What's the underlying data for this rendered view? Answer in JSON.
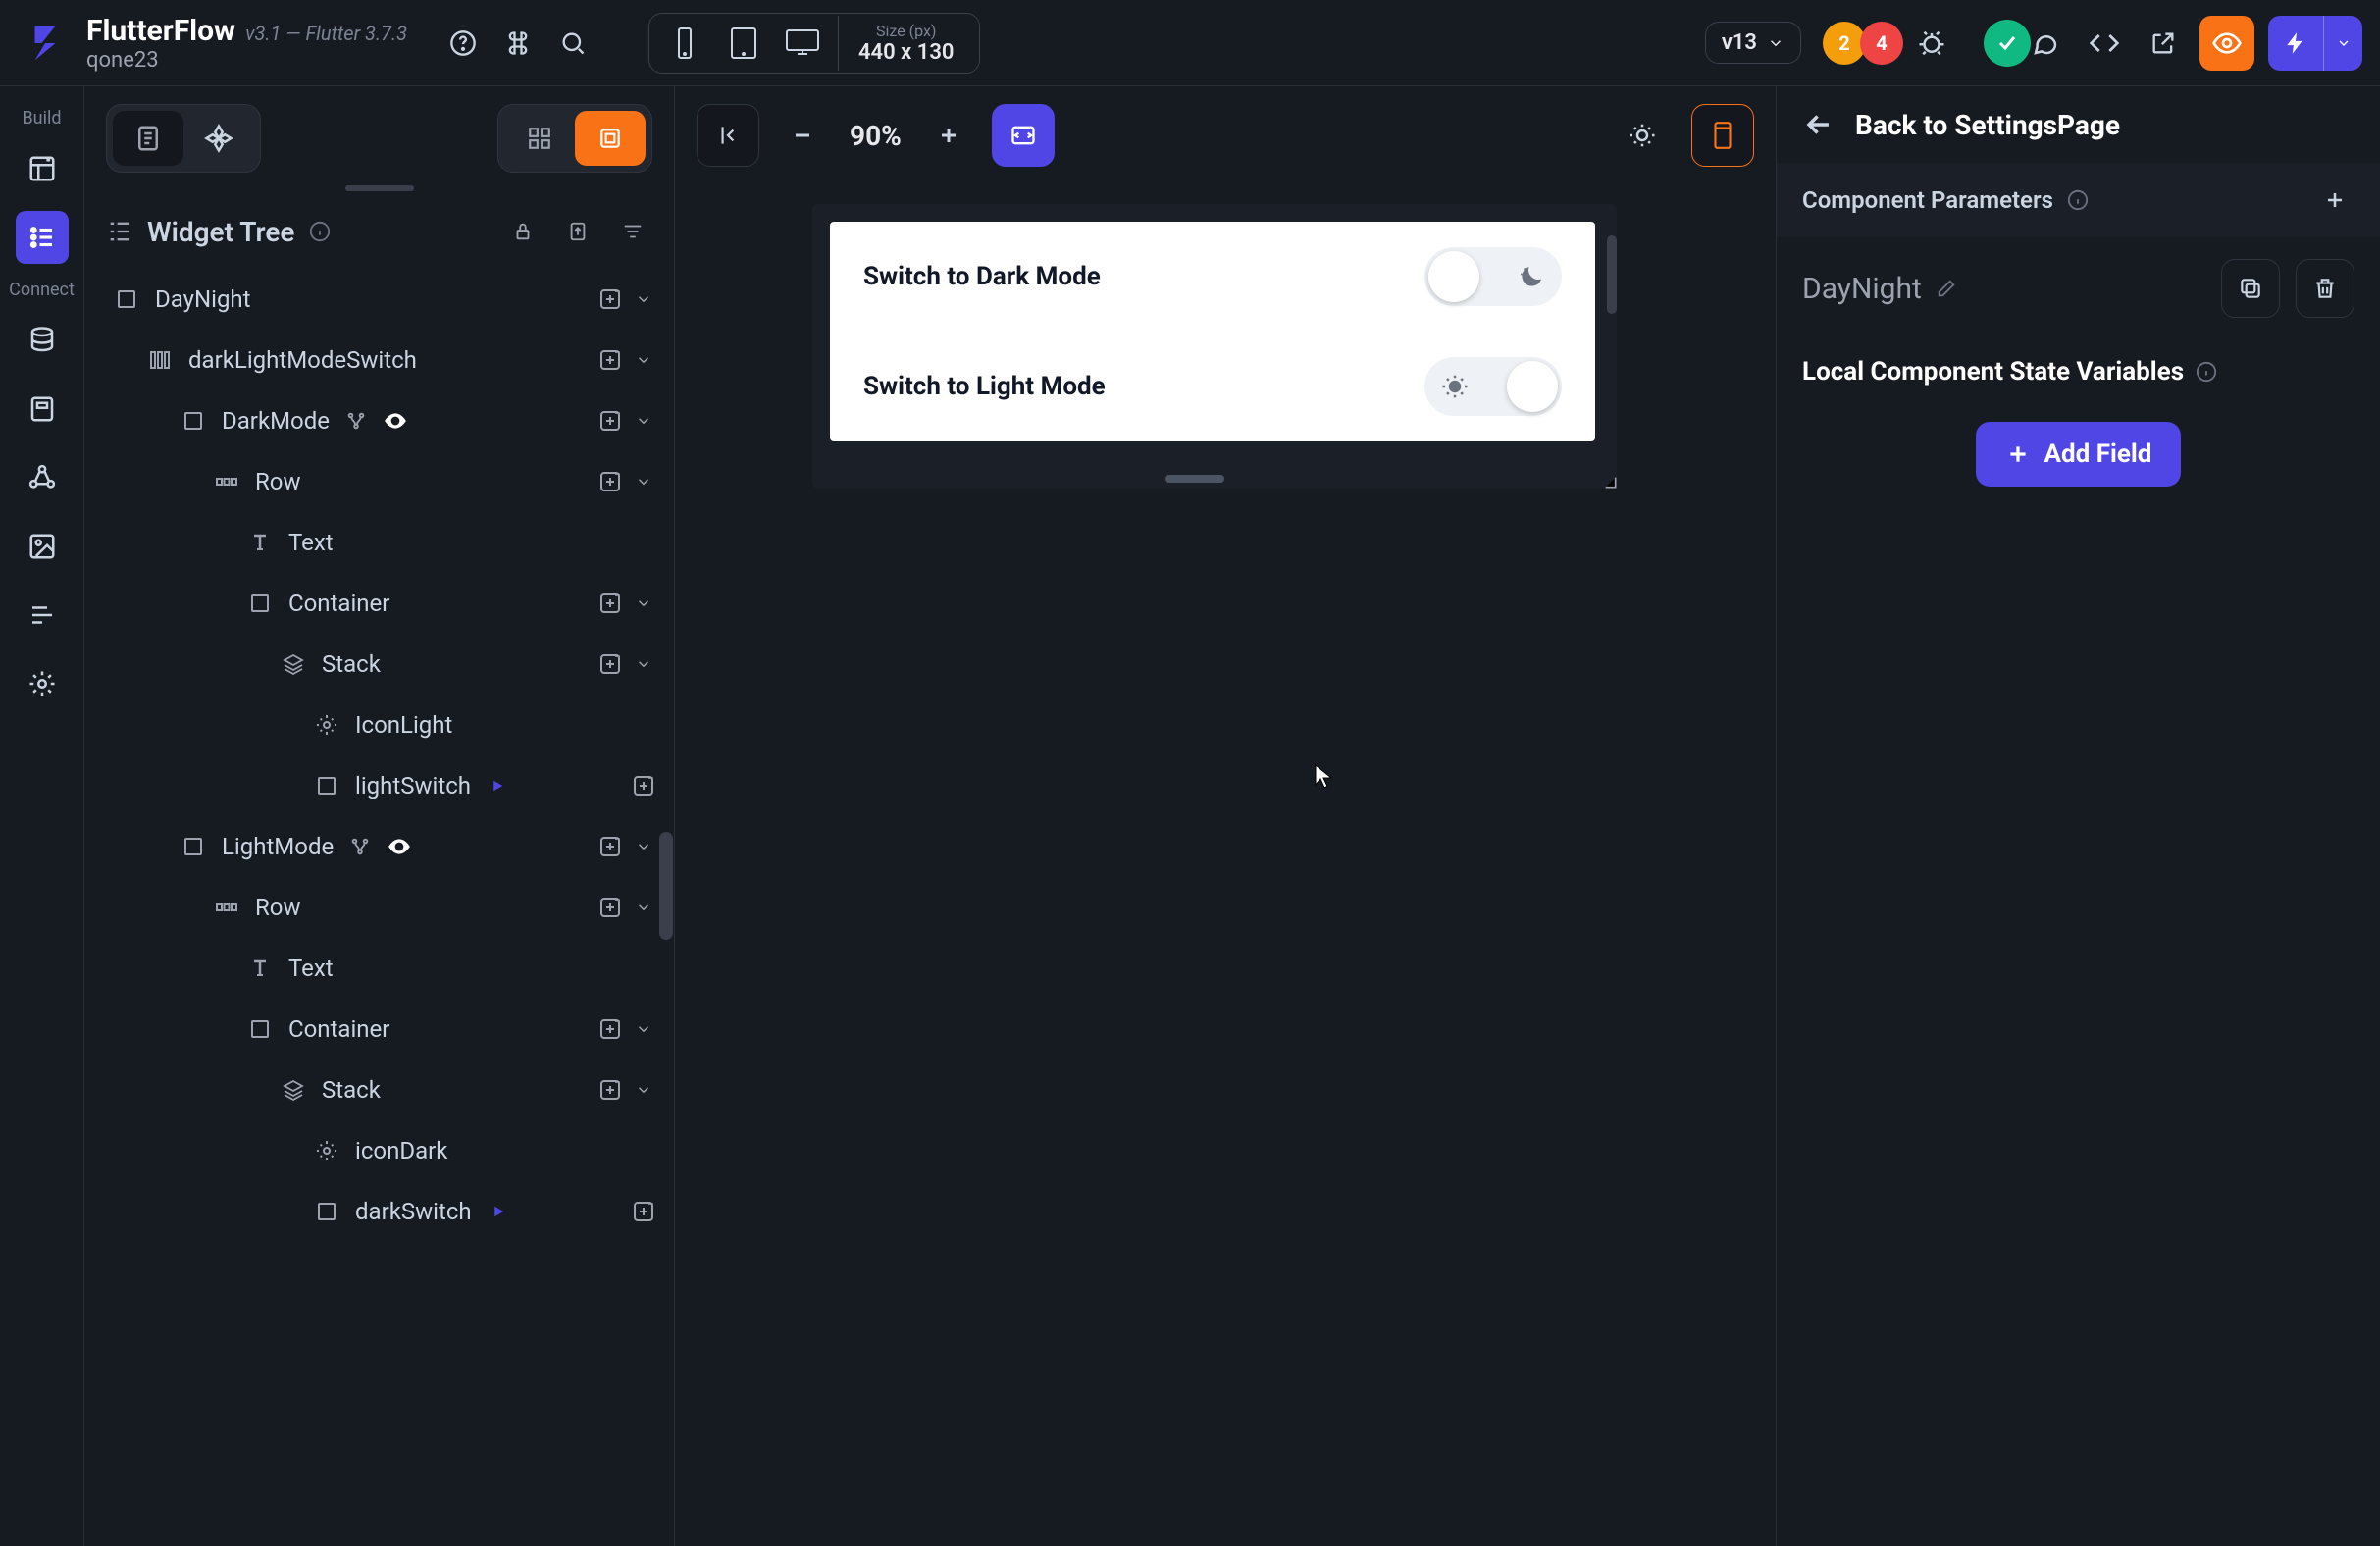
{
  "brand": {
    "name": "FlutterFlow",
    "version": "v3.1 — Flutter 3.7.3",
    "user": "qone23"
  },
  "top": {
    "size_label": "Size (px)",
    "size_value": "440 x 130",
    "version": "v13",
    "badge1": "2",
    "badge2": "4"
  },
  "leftrail": {
    "label_build": "Build",
    "label_connect": "Connect"
  },
  "tree": {
    "title": "Widget Tree",
    "nodes": [
      {
        "depth": 0,
        "icon": "box",
        "name": "DayNight",
        "has_add": true,
        "has_chevron": true
      },
      {
        "depth": 1,
        "icon": "switch",
        "name": "darkLightModeSwitch",
        "has_add": true,
        "has_chevron": true
      },
      {
        "depth": 2,
        "icon": "box",
        "name": "DarkMode",
        "has_branch": true,
        "has_eye": true,
        "has_add": true,
        "has_chevron": true
      },
      {
        "depth": 3,
        "icon": "row",
        "name": "Row",
        "has_add": true,
        "has_chevron": true
      },
      {
        "depth": 4,
        "icon": "text",
        "name": "Text"
      },
      {
        "depth": 4,
        "icon": "box",
        "name": "Container",
        "has_add": true,
        "has_chevron": true
      },
      {
        "depth": 5,
        "icon": "stack",
        "name": "Stack",
        "has_add": true,
        "has_chevron": true
      },
      {
        "depth": 6,
        "icon": "gear",
        "name": "IconLight"
      },
      {
        "depth": 6,
        "icon": "box",
        "name": "lightSwitch",
        "has_play": true,
        "has_add": true
      },
      {
        "depth": 2,
        "icon": "box",
        "name": "LightMode",
        "has_branch": true,
        "has_eye": true,
        "has_add": true,
        "has_chevron": true
      },
      {
        "depth": 3,
        "icon": "row",
        "name": "Row",
        "has_add": true,
        "has_chevron": true
      },
      {
        "depth": 4,
        "icon": "text",
        "name": "Text"
      },
      {
        "depth": 4,
        "icon": "box",
        "name": "Container",
        "has_add": true,
        "has_chevron": true
      },
      {
        "depth": 5,
        "icon": "stack",
        "name": "Stack",
        "has_add": true,
        "has_chevron": true
      },
      {
        "depth": 6,
        "icon": "gear",
        "name": "iconDark"
      },
      {
        "depth": 6,
        "icon": "box",
        "name": "darkSwitch",
        "has_play": true,
        "has_add": true
      }
    ]
  },
  "canvas": {
    "zoom": "90%",
    "row1": "Switch to Dark Mode",
    "row2": "Switch to Light Mode"
  },
  "right": {
    "back": "Back to SettingsPage",
    "params": "Component Parameters",
    "component": "DayNight",
    "state_title": "Local Component State Variables",
    "add_field": "Add Field"
  }
}
